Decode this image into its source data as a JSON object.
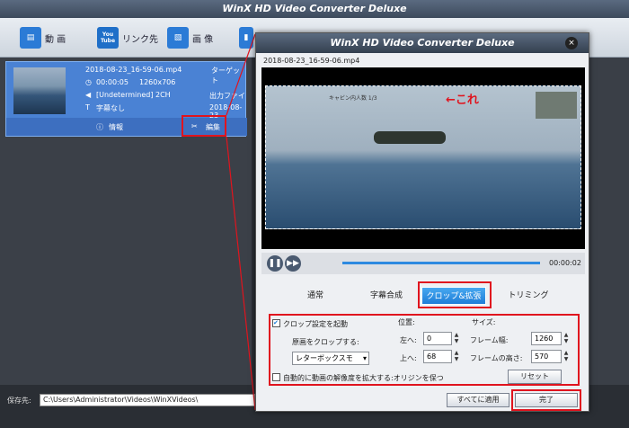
{
  "main": {
    "title": "WinX HD Video Converter Deluxe",
    "toolbar": {
      "video": "動 画",
      "youtube_icon": "You Tube",
      "link": "リンク先",
      "photo": "画 像"
    },
    "item": {
      "filename": "2018-08-23_16-59-06.mp4",
      "duration": "00:00:05",
      "resolution": "1260x706",
      "audio": "[Undetermined] 2CH",
      "subtitle": "字幕なし",
      "target_label": "ターゲット",
      "output_label": "出力ファイ",
      "output_name": "2018-08-23",
      "info_label": "情報",
      "edit_label": "編集"
    },
    "save_label": "保存先:",
    "save_path": "C:\\Users\\Administrator\\Videos\\WinXVideos\\"
  },
  "dialog": {
    "title": "WinX HD Video Converter Deluxe",
    "filename": "2018-08-23_16-59-06.mp4",
    "overlay_text": "←これ",
    "scene_caption": "キャビン内人数 1/3",
    "time": "00:00:02",
    "tabs": [
      "通常",
      "字幕合成",
      "クロップ&拡張",
      "トリミング"
    ],
    "crop": {
      "enable_label": "クロップ設定を起動",
      "enabled": true,
      "source_label": "原画をクロップする:",
      "mode_value": "レターボックスモ",
      "position_label": "位置:",
      "left_label": "左へ:",
      "left_value": "0",
      "top_label": "上へ:",
      "top_value": "68",
      "size_label": "サイズ:",
      "width_label": "フレーム幅:",
      "width_value": "1260",
      "height_label": "フレームの高さ:",
      "height_value": "570",
      "auto_expand_label": "自動的に動画の解像度を拡大する:オリジンを保つ",
      "reset_label": "リセット"
    },
    "apply_all_label": "すべてに適用",
    "done_label": "完了"
  },
  "colors": {
    "accent_red": "#e0141e",
    "active_tab": "#1e7ed8",
    "item_bg": "#4a82d4"
  }
}
